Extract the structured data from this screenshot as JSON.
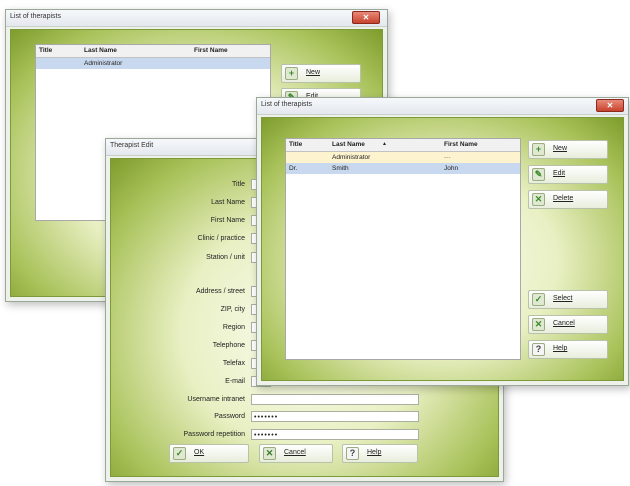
{
  "back_list": {
    "title": "List of therapists",
    "columns": [
      "Title",
      "Last Name",
      "First Name"
    ],
    "rows": [
      [
        "",
        "Administrator",
        ""
      ]
    ],
    "buttons": [
      "New",
      "Edit"
    ]
  },
  "edit_dialog": {
    "title": "Therapist Edit",
    "fields": [
      {
        "label": "Title",
        "value": ""
      },
      {
        "label": "Last Name",
        "value": ""
      },
      {
        "label": "First Name",
        "value": ""
      },
      {
        "label": "Clinic / practice",
        "value": ""
      },
      {
        "label": "Station / unit",
        "value": ""
      },
      {
        "label": "Address / street",
        "value": ""
      },
      {
        "label": "ZIP, city",
        "value": ""
      },
      {
        "label": "Region",
        "value": ""
      },
      {
        "label": "Telephone",
        "value": ""
      },
      {
        "label": "Telefax",
        "value": ""
      },
      {
        "label": "E-mail",
        "value": ""
      },
      {
        "label": "Username intranet",
        "value": ""
      },
      {
        "label": "Password",
        "value": "•••••••"
      },
      {
        "label": "Password repetition",
        "value": "•••••••"
      }
    ],
    "buttons": [
      "OK",
      "Cancel",
      "Help"
    ]
  },
  "front_list": {
    "title": "List of therapists",
    "columns": [
      "Title",
      "Last Name",
      "First Name"
    ],
    "sort_indicator": "▲",
    "rows": [
      [
        "",
        "Administrator",
        "---"
      ],
      [
        "Dr.",
        "Smith",
        "John"
      ]
    ],
    "buttons_top": [
      "New",
      "Edit",
      "Delete"
    ],
    "buttons_bottom": [
      "Select",
      "Cancel",
      "Help"
    ]
  },
  "colors": {
    "accent_green": "#7e9c2c",
    "selected_row": "#c8d8ee",
    "highlight_row": "#fdf3cf"
  }
}
